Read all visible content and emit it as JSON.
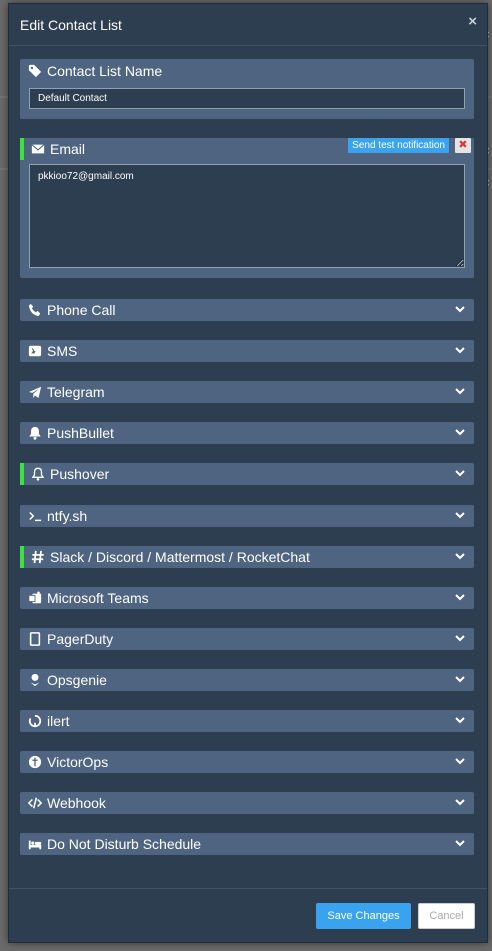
{
  "modal": {
    "title": "Edit Contact List",
    "close_symbol": "×"
  },
  "contact_list_name": {
    "label": "Contact List Name",
    "value": "Default Contact"
  },
  "email": {
    "label": "Email",
    "send_test_label": "Send test notification",
    "delete_symbol": "✖",
    "textarea_value": "pkkioo72@gmail.com"
  },
  "channels": [
    {
      "label": "Phone Call",
      "icon": "phone-icon",
      "active": false
    },
    {
      "label": "SMS",
      "icon": "sms-icon",
      "active": false
    },
    {
      "label": "Telegram",
      "icon": "telegram-icon",
      "active": false
    },
    {
      "label": "PushBullet",
      "icon": "bell-icon",
      "active": false
    },
    {
      "label": "Pushover",
      "icon": "bell-outline-icon",
      "active": true
    },
    {
      "label": "ntfy.sh",
      "icon": "terminal-icon",
      "active": false
    },
    {
      "label": "Slack / Discord / Mattermost / RocketChat",
      "icon": "hashtag-icon",
      "active": true
    },
    {
      "label": "Microsoft Teams",
      "icon": "teams-icon",
      "active": false
    },
    {
      "label": "PagerDuty",
      "icon": "pagerduty-icon",
      "active": false
    },
    {
      "label": "Opsgenie",
      "icon": "opsgenie-icon",
      "active": false
    },
    {
      "label": "ilert",
      "icon": "ilert-icon",
      "active": false
    },
    {
      "label": "VictorOps",
      "icon": "victorops-icon",
      "active": false
    },
    {
      "label": "Webhook",
      "icon": "code-icon",
      "active": false
    },
    {
      "label": "Do Not Disturb Schedule",
      "icon": "bed-icon",
      "active": false
    }
  ],
  "footer": {
    "save_label": "Save Changes",
    "cancel_label": "Cancel"
  },
  "colors": {
    "modal_bg": "#2c3e50",
    "panel_bg": "#4e6480",
    "accent": "#3aa3f0",
    "active_marker": "#3ee23e",
    "danger": "#d9363e"
  }
}
